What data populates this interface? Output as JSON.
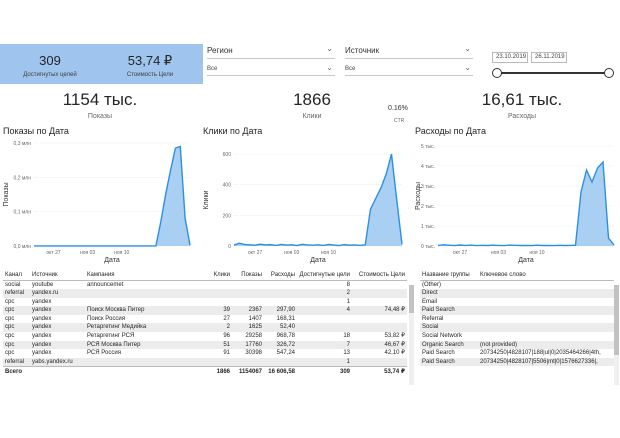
{
  "kpi": {
    "goals_value": "309",
    "goals_label": "Достигнутых целей",
    "cost_goal_value": "53,74 ₽",
    "cost_goal_label": "Стоимость Цели"
  },
  "slicers": {
    "region": {
      "title": "Регион",
      "value": "Все"
    },
    "source": {
      "title": "Источник",
      "value": "Все"
    },
    "date_range": {
      "start": "23.10.2019",
      "end": "26.11.2019"
    }
  },
  "cards": {
    "impressions": {
      "value": "1154 тыс.",
      "label": "Показы"
    },
    "clicks": {
      "value": "1866",
      "label": "Клики"
    },
    "ctr": {
      "value": "0.16%",
      "label": "CTR"
    },
    "spend": {
      "value": "16,61 тыс.",
      "label": "Расходы"
    }
  },
  "chart_data": [
    {
      "type": "area",
      "title": "Показы по Дата",
      "xlabel": "Дата",
      "ylabel": "Показы",
      "y_ticks": [
        "0,0 млн",
        "0,1 млн",
        "0,2 млн",
        "0,3 млн"
      ],
      "ylim": [
        0,
        0.3
      ],
      "x_ticks": [
        "окт 27",
        "ноя 03",
        "ноя 10"
      ],
      "series": [
        {
          "values": [
            0.0002,
            0.0002,
            0.0002,
            0.0002,
            0.0002,
            0.0002,
            0.0002,
            0.0002,
            0.0002,
            0.0002,
            0.0002,
            0.0002,
            0.0002,
            0.0002,
            0.0002,
            0.0002,
            0.0002,
            0.0002,
            0.0002,
            0.0002,
            0.0002,
            0.0002,
            0.0002,
            0.0002,
            0.0002,
            0.0003,
            0.07,
            0.15,
            0.22,
            0.285,
            0.29,
            0.08,
            0.002
          ]
        }
      ]
    },
    {
      "type": "area",
      "title": "Клики по Дата",
      "xlabel": "Дата",
      "ylabel": "Клики",
      "y_ticks": [
        "0",
        "200",
        "400",
        "600"
      ],
      "ylim": [
        0,
        600
      ],
      "x_ticks": [
        "окт 27",
        "ноя 03",
        "ноя 10"
      ],
      "series": [
        {
          "values": [
            6,
            18,
            10,
            8,
            5,
            12,
            7,
            9,
            4,
            10,
            6,
            8,
            3,
            11,
            7,
            5,
            8,
            4,
            10,
            6,
            3,
            9,
            5,
            7,
            4,
            8,
            240,
            310,
            380,
            470,
            600,
            300,
            10
          ]
        }
      ]
    },
    {
      "type": "area",
      "title": "Расходы по Дата",
      "xlabel": "Дата",
      "ylabel": "Расходы",
      "y_ticks": [
        "0 тыс.",
        "1 тыс.",
        "2 тыс.",
        "3 тыс.",
        "4 тыс.",
        "5 тыс."
      ],
      "ylim": [
        0,
        5000
      ],
      "x_ticks": [
        "окт 27",
        "ноя 03",
        "ноя 10"
      ],
      "series": [
        {
          "values": [
            30,
            60,
            40,
            20,
            50,
            30,
            45,
            20,
            35,
            25,
            40,
            30,
            20,
            45,
            35,
            25,
            30,
            20,
            40,
            25,
            30,
            20,
            35,
            25,
            30,
            40,
            2700,
            3800,
            3200,
            3900,
            4200,
            400,
            50
          ]
        }
      ]
    }
  ],
  "main_table": {
    "headers": [
      "Канал",
      "Источник",
      "Кампания",
      "Клики",
      "Показы",
      "Расходы",
      "Достигнутые цели",
      "Стоимость Цели"
    ],
    "rows": [
      [
        "social",
        "youtube",
        "announcemet",
        "",
        "",
        "",
        "8",
        ""
      ],
      [
        "referral",
        "yandex.ru",
        "",
        "",
        "",
        "",
        "2",
        ""
      ],
      [
        "cpc",
        "yandex",
        "",
        "",
        "",
        "",
        "1",
        ""
      ],
      [
        "cpc",
        "yandex",
        "Поиск Москва Питер",
        "39",
        "2367",
        "297,90",
        "4",
        "74,48 ₽"
      ],
      [
        "cpc",
        "yandex",
        "Поиск Россия",
        "27",
        "1407",
        "168,31",
        "",
        ""
      ],
      [
        "cpc",
        "yandex",
        "Ретаргетинг Медийка",
        "2",
        "1625",
        "52,40",
        "",
        ""
      ],
      [
        "cpc",
        "yandex",
        "Ретаргетинг РСЯ",
        "96",
        "29258",
        "968,78",
        "18",
        "53,82 ₽"
      ],
      [
        "cpc",
        "yandex",
        "РСЯ Москва Питер",
        "51",
        "17760",
        "326,72",
        "7",
        "46,67 ₽"
      ],
      [
        "cpc",
        "yandex",
        "РСЯ Россия",
        "91",
        "30398",
        "547,24",
        "13",
        "42,10 ₽"
      ],
      [
        "referral",
        "yabs.yandex.ru",
        "",
        "",
        "",
        "",
        "1",
        ""
      ]
    ],
    "total": [
      "Всего",
      "",
      "",
      "1866",
      "1154067",
      "16 606,58",
      "309",
      "53,74 ₽"
    ]
  },
  "keyword_table": {
    "headers": [
      "Название группы",
      "Ключевое слово"
    ],
    "rows": [
      [
        "(Other)",
        ""
      ],
      [
        "Direct",
        ""
      ],
      [
        "Email",
        ""
      ],
      [
        "Paid Search",
        ""
      ],
      [
        "Referral",
        ""
      ],
      [
        "Social",
        ""
      ],
      [
        "Social Network",
        ""
      ],
      [
        "Organic Search",
        "(not provided)"
      ],
      [
        "Paid Search",
        "20734250|4828107|188|ul|0|2035464266|4th,"
      ],
      [
        "Paid Search",
        "20734250|4828107|5506|mt|0|1576627336|,"
      ]
    ]
  }
}
